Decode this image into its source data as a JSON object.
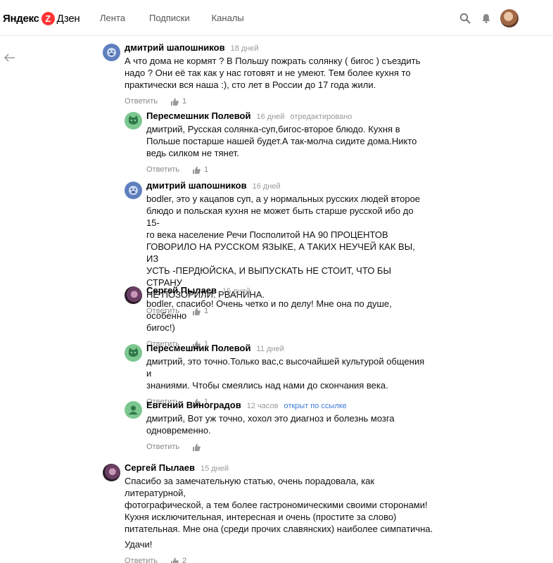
{
  "header": {
    "logo_part1": "Яндекс",
    "logo_mark": "Z",
    "logo_part2": "Дзен",
    "nav": [
      "Лента",
      "Подписки",
      "Каналы"
    ]
  },
  "comments": [
    {
      "author": "дмитрий шапошников",
      "date": "18 дней",
      "text": "А что дома не кормят ? В Польшу пожрать солянку ( бигос ) съездить\nнадо ? Они её так как у нас готовят и не умеют. Тем более кухня то\nпрактически вся наша :), сто лет в России до 17 года жили.",
      "reply": "Ответить",
      "likes": "1"
    },
    {
      "author": "Пересмешник Полевой",
      "date": "16 дней",
      "edited": "отредактировано",
      "text": "дмитрий, Русская солянка-суп,бигос-второе блюдо. Кухня в\nПольше постарше нашей будет.А так-молча сидите дома.Никто\nведь силком не тянет.",
      "reply": "Ответить",
      "likes": "1"
    },
    {
      "author": "дмитрий шапошников",
      "date": "16 дней",
      "text": "bodler, это у кацапов суп, а у нормальных русских людей второе\nблюдо и польская кухня не может быть старше русской ибо до 15-\nго века население Речи Посполитой НА 90 ПРОЦЕНТОВ\nГОВОРИЛО НА РУССКОМ ЯЗЫКЕ, А ТАКИХ НЕУЧЕЙ КАК ВЫ, ИЗ\nУСТЬ -ПЕРДЮЙСКА, И ВЫПУСКАТЬ НЕ СТОИТ, ЧТО БЫ СТРАНУ\nНЕ ПОЗОРИЛИ. РВАНИНА.",
      "reply": "Ответить",
      "likes": "1"
    },
    {
      "author": "Сергей Пылаев",
      "date": "15 дней",
      "text": "bodler, спасибо! Очень четко и по делу! Мне она по душе, особенно\nбигос!)",
      "reply": "Ответить",
      "likes": "1"
    },
    {
      "author": "Пересмешник Полевой",
      "date": "11 дней",
      "text": "дмитрий, это точно.Только вас,с высочайшей культурой общения и\nзнаниями. Чтобы смеялись над нами до скончания века.",
      "reply": "Ответить",
      "likes": "1"
    },
    {
      "author": "Евгений Виноградов",
      "date": "12 часов",
      "link": "открыт по ссылке",
      "text": "дмитрий, Вот уж точно, хохол это диагноз и болезнь мозга\nодновременно.",
      "reply": "Ответить",
      "likes": ""
    },
    {
      "author": "Сергей Пылаев",
      "date": "15 дней",
      "text": "Спасибо за замечательную статью, очень порадовала, как литературной,\nфотографической, а тем более гастрономическими своими сторонами!\nКухня исключительная, интересная и очень (простите за слово)\nпитательная. Мне она (среди прочих славянских) наиболее симпатична.",
      "text2": "Удачи!",
      "reply": "Ответить",
      "likes": "2"
    }
  ]
}
